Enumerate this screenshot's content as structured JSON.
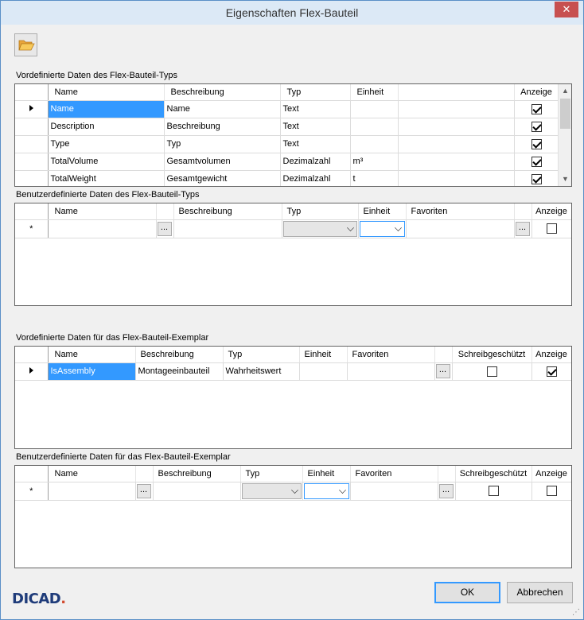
{
  "window": {
    "title": "Eigenschaften Flex-Bauteil",
    "close_label": "✕"
  },
  "toolbar": {
    "open_icon": "folder-open-icon"
  },
  "section1": {
    "label": "Vordefinierte Daten des Flex-Bauteil-Typs",
    "headers": [
      "Name",
      "Beschreibung",
      "Typ",
      "Einheit",
      "",
      "Anzeige"
    ],
    "rows": [
      {
        "name": "Name",
        "beschreibung": "Name",
        "typ": "Text",
        "einheit": "",
        "anzeige": true
      },
      {
        "name": "Description",
        "beschreibung": "Beschreibung",
        "typ": "Text",
        "einheit": "",
        "anzeige": true
      },
      {
        "name": "Type",
        "beschreibung": "Typ",
        "typ": "Text",
        "einheit": "",
        "anzeige": true
      },
      {
        "name": "TotalVolume",
        "beschreibung": "Gesamtvolumen",
        "typ": "Dezimalzahl",
        "einheit": "m³",
        "anzeige": true
      },
      {
        "name": "TotalWeight",
        "beschreibung": "Gesamtgewicht",
        "typ": "Dezimalzahl",
        "einheit": "t",
        "anzeige": true
      }
    ]
  },
  "section2": {
    "label": "Benutzerdefinierte Daten des Flex-Bauteil-Typs",
    "headers": [
      "Name",
      "Beschreibung",
      "Typ",
      "Einheit",
      "Favoriten",
      "Anzeige"
    ],
    "new_row_marker": "*",
    "ellipsis": "..."
  },
  "section3": {
    "label": "Vordefinierte Daten für das Flex-Bauteil-Exemplar",
    "headers": [
      "Name",
      "Beschreibung",
      "Typ",
      "Einheit",
      "Favoriten",
      "Schreibgeschützt",
      "Anzeige"
    ],
    "rows": [
      {
        "name": "IsAssembly",
        "beschreibung": "Montageeinbauteil",
        "typ": "Wahrheitswert",
        "einheit": "",
        "favoriten": "",
        "schreibgeschuetzt": false,
        "anzeige": true
      }
    ],
    "ellipsis": "..."
  },
  "section4": {
    "label": "Benutzerdefinierte Daten für das Flex-Bauteil-Exemplar",
    "headers": [
      "Name",
      "Beschreibung",
      "Typ",
      "Einheit",
      "Favoriten",
      "Schreibgeschützt",
      "Anzeige"
    ],
    "new_row_marker": "*",
    "ellipsis": "..."
  },
  "footer": {
    "logo_text": "DICAD",
    "ok_label": "OK",
    "cancel_label": "Abbrechen"
  }
}
